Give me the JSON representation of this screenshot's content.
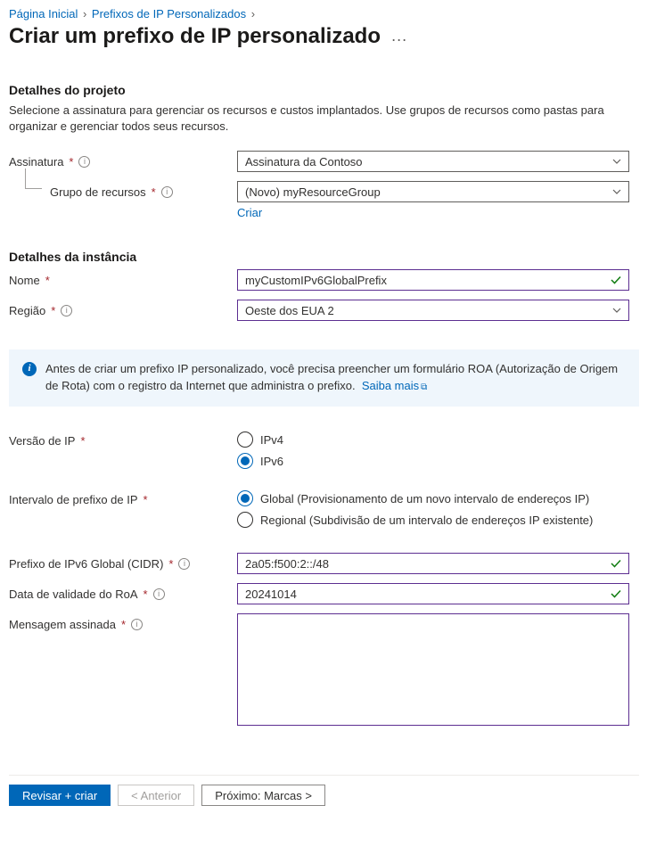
{
  "breadcrumb": {
    "home": "Página Inicial",
    "level1": "Prefixos de IP Personalizados"
  },
  "page_title": "Criar um prefixo de IP personalizado",
  "project": {
    "heading": "Detalhes do projeto",
    "description": "Selecione a assinatura para gerenciar os recursos e custos implantados. Use grupos de recursos como pastas para organizar e gerenciar todos seus recursos.",
    "subscription_label": "Assinatura",
    "subscription_value": "Assinatura da Contoso",
    "rg_label": "Grupo de recursos",
    "rg_value": "(Novo) myResourceGroup",
    "rg_create": "Criar"
  },
  "instance": {
    "heading": "Detalhes da instância",
    "name_label": "Nome",
    "name_value": "myCustomIPv6GlobalPrefix",
    "region_label": "Região",
    "region_value": "Oeste dos EUA 2"
  },
  "info": {
    "text": "Antes de criar um prefixo IP personalizado, você precisa preencher um formulário ROA (Autorização de Origem de Rota) com o registro da Internet que administra o prefixo.",
    "learn_more": "Saiba mais"
  },
  "ipver": {
    "label": "Versão de IP",
    "opt1": "IPv4",
    "opt2": "IPv6",
    "selected": "IPv6"
  },
  "range": {
    "label": "Intervalo de prefixo de IP",
    "opt1": "Global (Provisionamento de um novo intervalo de endereços IP)",
    "opt2": "Regional (Subdivisão de um intervalo de endereços IP existente)",
    "selected": "global"
  },
  "cidr": {
    "label": "Prefixo de IPv6 Global (CIDR)",
    "value": "2a05:f500:2::/48"
  },
  "roa": {
    "label": "Data de validade do RoA",
    "value": "20241014"
  },
  "signed": {
    "label": "Mensagem assinada",
    "value": ""
  },
  "footer": {
    "review": "Revisar + criar",
    "prev": "< Anterior",
    "next": "Próximo: Marcas >"
  }
}
